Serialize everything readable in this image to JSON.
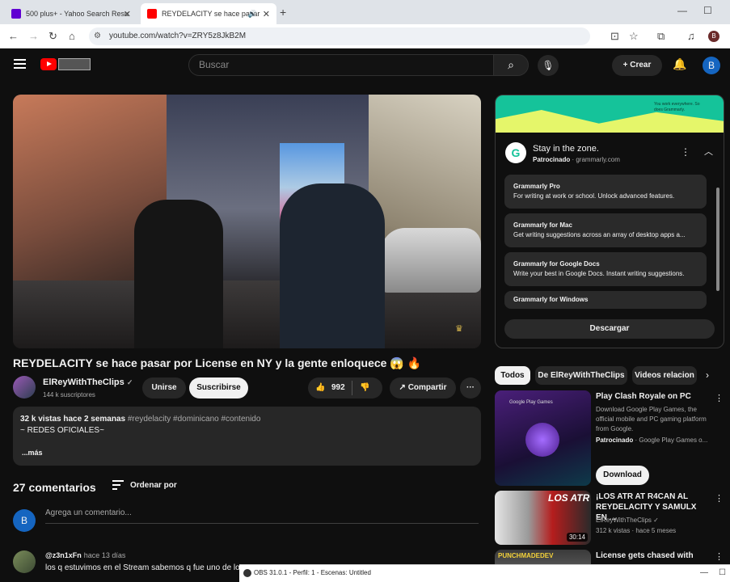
{
  "browser": {
    "tabs": [
      {
        "title": "500 plus+ - Yahoo Search Resu",
        "favicon": "yahoo-icon",
        "color": "#6001d2"
      },
      {
        "title": "REYDELACITY se hace pasar",
        "favicon": "youtube-icon",
        "color": "#ff0000"
      }
    ],
    "new_tab": "+",
    "url": "youtube.com/watch?v=ZRY5z8JkB2M",
    "profile_initial": "B"
  },
  "yt_header": {
    "search_placeholder": "Buscar",
    "create_label": "Crear",
    "avatar_initial": "B"
  },
  "video": {
    "title": "REYDELACITY se hace pasar por License en NY y la gente enloquece 😱 🔥",
    "channel_name": "ElReyWithTheClips",
    "verified": "✓",
    "subscribers": "144 k suscriptores",
    "join_label": "Unirse",
    "subscribe_label": "Suscribirse",
    "likes": "992",
    "share_label": "Compartir",
    "more": "···"
  },
  "description": {
    "stats": "32 k vistas  hace 2 semanas",
    "hashtags": "#reydelacity #dominicano #contenido",
    "line2": "~ REDES OFICIALES~",
    "more_label": "...más"
  },
  "comments": {
    "count_label": "27 comentarios",
    "sort_label": "Ordenar por",
    "input_avatar": "B",
    "input_placeholder": "Agrega un comentario...",
    "items": [
      {
        "user": "@z3n1xFn",
        "time": "hace 13 días",
        "text": "los q estuvimos en el Stream sabemos q fue uno de los"
      }
    ]
  },
  "ad": {
    "banner_text": "You work everywhere. So does Grammarly.",
    "logo_letter": "G",
    "title": "Stay in the zone.",
    "sponsored": "Patrocinado",
    "domain": "grammarly.com",
    "cards": [
      {
        "heading": "Grammarly Pro",
        "desc": "For writing at work or school. Unlock advanced features."
      },
      {
        "heading": "Grammarly for Mac",
        "desc": "Get writing suggestions across an array of desktop apps a..."
      },
      {
        "heading": "Grammarly for Google Docs",
        "desc": "Write your best in Google Docs. Instant writing suggestions."
      },
      {
        "heading": "Grammarly for Windows",
        "desc": ""
      }
    ],
    "download_label": "Descargar"
  },
  "chips": [
    "Todos",
    "De ElReyWithTheClips",
    "Videos relacion"
  ],
  "recommendations": [
    {
      "title": "Play Clash Royale on PC",
      "desc": "Download Google Play Games, the official mobile and PC gaming platform from Google.",
      "sponsor": "Patrocinado",
      "sponsor_by": "· Google Play Games o...",
      "thumb_label": "Google Play Games",
      "button": "Download"
    },
    {
      "title": "¡LOS ATR AT R4CAN AL REYDELACITY Y SAMULX EN ...",
      "channel": "ElReyWithTheClips",
      "meta": "312 k vistas · hace 5 meses",
      "duration": "30:14",
      "thumb_label": "LOS ATR"
    },
    {
      "title": "License gets chased with",
      "thumb_label": "PUNCHMADEDEV"
    }
  ],
  "obs_bar": {
    "text": "OBS 31.0.1 - Perfil: 1 - Escenas: Untitled"
  }
}
